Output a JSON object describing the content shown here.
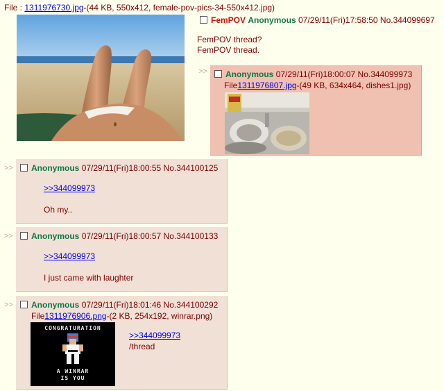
{
  "op": {
    "file_prefix": "File : ",
    "file_link": "1311976730.jpg",
    "file_info": "-(44 KB, 550x412, female-pov-pics-34-550x412.jpg)",
    "subject": "FemPOV",
    "name": "Anonymous",
    "datetime": "07/29/11(Fri)17:58:50",
    "post_no": "No.344099697",
    "lines": [
      "FemPOV thread?",
      "FemPOV thread."
    ]
  },
  "arrow": ">>",
  "replies": [
    {
      "name": "Anonymous",
      "datetime": "07/29/11(Fri)18:00:07",
      "post_no": "No.344099973",
      "file_prefix": "File",
      "file_link": "1311976807.jpg",
      "file_info": "-(49 KB, 634x464, dishes1.jpg)"
    },
    {
      "name": "Anonymous",
      "datetime": "07/29/11(Fri)18:00:55",
      "post_no": "No.344100125",
      "quote": ">>344099973",
      "text": "Oh my.."
    },
    {
      "name": "Anonymous",
      "datetime": "07/29/11(Fri)18:00:57",
      "post_no": "No.344100133",
      "quote": ">>344099973",
      "text": "I just came with laughter"
    },
    {
      "name": "Anonymous",
      "datetime": "07/29/11(Fri)18:01:46",
      "post_no": "No.344100292",
      "file_prefix": "File",
      "file_link": "1311976906.png",
      "file_info": "-(2 KB, 254x192, winrar.png)",
      "quote": ">>344099973",
      "text": "/thread",
      "image_text_top": "CONGRATURATION",
      "image_text_bottom_1": "A WINRAR",
      "image_text_bottom_2": "IS YOU"
    }
  ]
}
